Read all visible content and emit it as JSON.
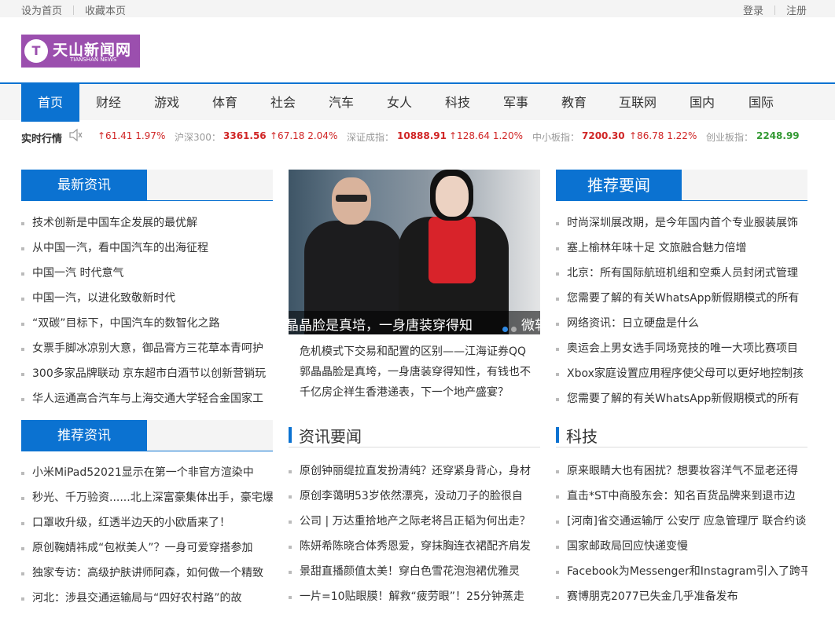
{
  "topbar": {
    "set_home": "设为首页",
    "bookmark": "收藏本页",
    "login": "登录",
    "register": "注册"
  },
  "logo": {
    "mark": "T",
    "name_cn": "天山新闻网",
    "name_en": "TIANSHAN NEWS",
    "color": "#9b4fae"
  },
  "nav": {
    "accent_color": "#0b72d1",
    "items": [
      "首页",
      "财经",
      "游戏",
      "体育",
      "社会",
      "汽车",
      "女人",
      "科技",
      "军事",
      "教育",
      "互联网",
      "国内",
      "国际"
    ]
  },
  "ticker": {
    "label": "实时行情",
    "icon": "speaker-icon",
    "first_change": "↑61.41 1.97%",
    "items": [
      {
        "name": "沪深300：",
        "value": "3361.56",
        "change": "↑67.18 2.04%"
      },
      {
        "name": "深证成指：",
        "value": "10888.91",
        "change": "↑128.64 1.20%"
      },
      {
        "name": "中小板指：",
        "value": "7200.30",
        "change": "↑86.78 1.22%"
      },
      {
        "name": "创业板指：",
        "value": "2248.99"
      }
    ]
  },
  "latest": {
    "title": "最新资讯",
    "items": [
      "技术创新是中国车企发展的最优解",
      "从中国一汽，看中国汽车的出海征程",
      "中国一汽 时代意气",
      "中国一汽，以进化致敬新时代",
      "“双碳”目标下，中国汽车的数智化之路",
      "女票手脚冰凉别大意，御品膏方三花草本青呵护",
      "300多家品牌联动 京东超市白酒节以创新营销玩",
      "华人运通高合汽车与上海交通大学轻合金国家工"
    ]
  },
  "slider": {
    "caption_main": "晶晶脸是真培，一身唐装穿得知",
    "caption_next": "微软",
    "links": [
      "危机模式下交易和配置的区别——江海证券QQ",
      "郭晶晶脸是真垮，一身唐装穿得知性，有钱也不",
      "千亿房企祥生香港递表，下一个地产盛宴？"
    ]
  },
  "featured": {
    "title": "推荐要闻",
    "items": [
      "时尚深圳展改期，是今年国内首个专业服装展饰",
      "塞上榆林年味十足 文旅融合魅力倍增",
      "北京：所有国际航班机组和空乘人员封闭式管理",
      "您需要了解的有关WhatsApp新假期模式的所有",
      "网络资讯：日立硬盘是什么",
      "奥运会上男女选手同场竞技的唯一大项比赛项目",
      "Xbox家庭设置应用程序使父母可以更好地控制孩",
      "您需要了解的有关WhatsApp新假期模式的所有"
    ]
  },
  "recommend": {
    "title": "推荐资讯",
    "items": [
      "小米MiPad52021显示在第一个非官方渲染中",
      "秒光、千万验资......北上深富豪集体出手，豪宅爆",
      "口罩收升级，红透半边天的小欧盾来了！",
      "原创鞠婧祎成“包袱美人”？一身可爱穿搭参加",
      "独家专访：高级护肤讲师阿森，如何做一个精致",
      "河北：涉县交通运输局与“四好农村路”的故"
    ]
  },
  "headlines": {
    "title": "资讯要闻",
    "items": [
      "原创钟丽缇拉直发扮清纯？还穿紧身背心，身材",
      "原创李蔼明53岁依然漂亮，没动刀子的脸很自",
      "公司 | 万达重拾地产之际老将吕正韬为何出走？",
      "陈妍希陈晓合体秀恩爱，穿抹胸连衣裙配齐肩发",
      "景甜直播颜值太美！穿白色雪花泡泡裙优雅灵",
      "一片=10贴眼膜！解救“疲劳眼”！25分钟蒸走"
    ]
  },
  "tech": {
    "title": "科技",
    "items": [
      "原来眼睛大也有困扰？想要妆容洋气不显老还得",
      "直击*ST中商股东会：知名百货品牌来到退市边",
      "[河南]省交通运输厅 公安厅 应急管理厅 联合约谈",
      "国家邮政局回应快递变慢",
      "Facebook为Messenger和Instagram引入了跨平",
      "赛博朋克2077已失金几乎准备发布"
    ]
  }
}
